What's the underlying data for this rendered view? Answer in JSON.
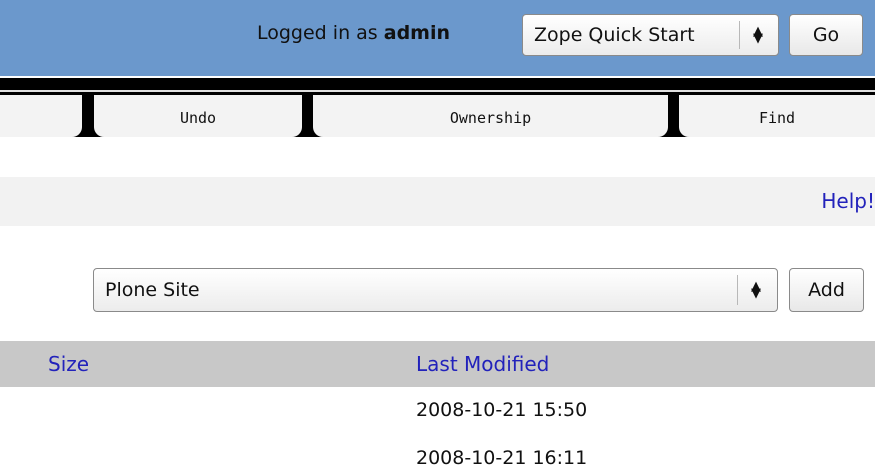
{
  "header": {
    "logged_in_prefix": "Logged in as",
    "username": "admin",
    "quick_start_select": "Zope Quick Start",
    "go_button": "Go"
  },
  "tabs": [
    {
      "label": ""
    },
    {
      "label": "Undo"
    },
    {
      "label": "Ownership"
    },
    {
      "label": "Find"
    }
  ],
  "help_link": "Help!",
  "add_bar": {
    "selected_type": "Plone Site",
    "add_button": "Add"
  },
  "table": {
    "headers": {
      "size": "Size",
      "last_modified": "Last Modified"
    },
    "rows": [
      {
        "size": "",
        "last_modified": "2008-10-21 15:50"
      },
      {
        "size": "",
        "last_modified": "2008-10-21 16:11"
      }
    ]
  },
  "colors": {
    "header_bg": "#6b98cc",
    "link": "#2222bb",
    "table_header_bg": "#c8c8c8"
  }
}
